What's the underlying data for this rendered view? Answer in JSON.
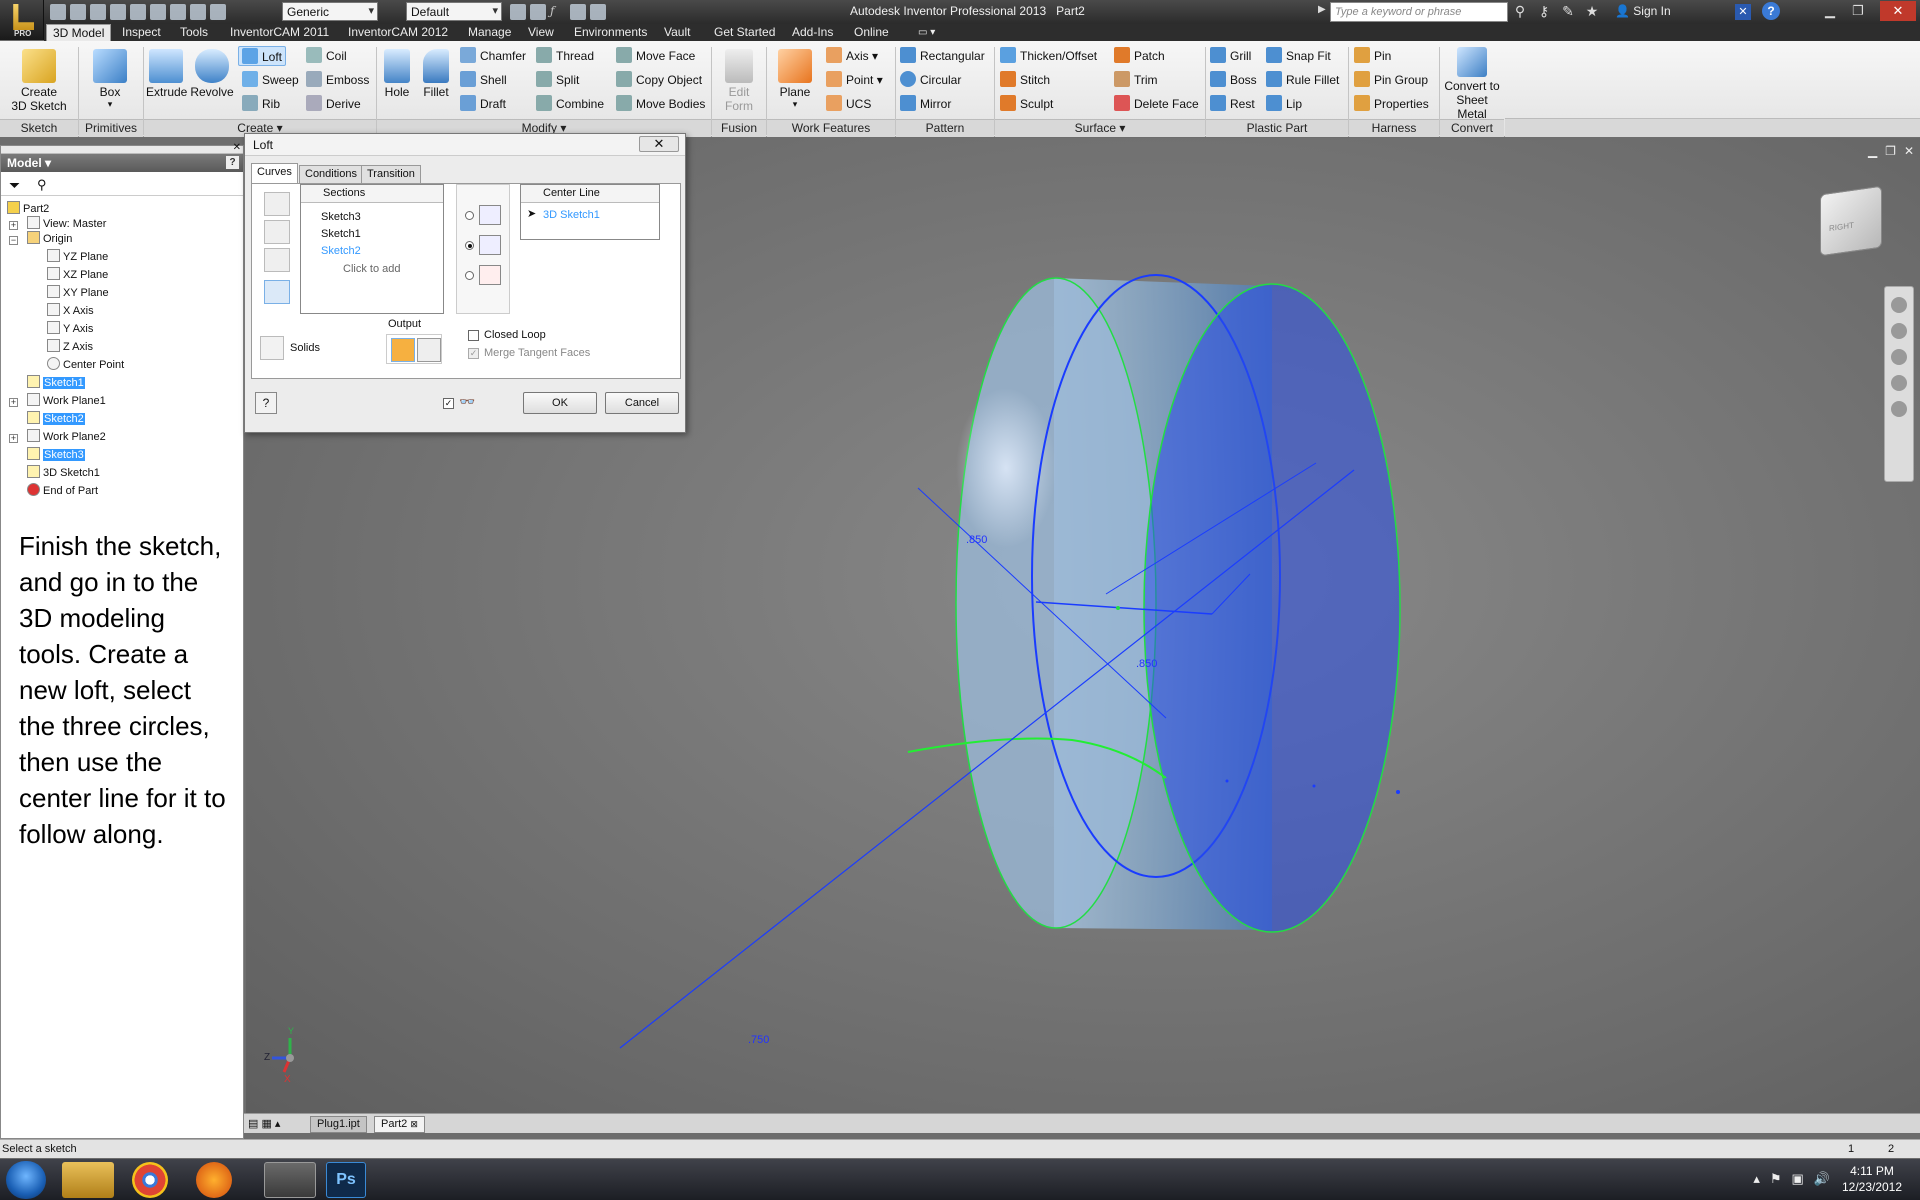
{
  "titlebar": {
    "title": "Autodesk Inventor Professional 2013",
    "doc": "Part2",
    "app_badge": "PRO",
    "material_combo": "Generic",
    "appearance_combo": "Default",
    "search_placeholder": "Type a keyword or phrase",
    "sign_in": "Sign In"
  },
  "menu": {
    "tabs": [
      "3D Model",
      "Inspect",
      "Tools",
      "InventorCAM 2011",
      "InventorCAM 2012",
      "Manage",
      "View",
      "Environments",
      "Vault",
      "Get Started",
      "Add-Ins",
      "Online"
    ],
    "active": "3D Model"
  },
  "ribbon": {
    "sketch": {
      "create_line1": "Create",
      "create_line2": "3D Sketch",
      "label": "Sketch"
    },
    "primitives": {
      "box": "Box",
      "label": "Primitives"
    },
    "create": {
      "extrude": "Extrude",
      "revolve": "Revolve",
      "loft": "Loft",
      "sweep": "Sweep",
      "rib": "Rib",
      "coil": "Coil",
      "emboss": "Emboss",
      "derive": "Derive",
      "label": "Create"
    },
    "modify": {
      "hole": "Hole",
      "fillet": "Fillet",
      "chamfer": "Chamfer",
      "shell": "Shell",
      "draft": "Draft",
      "thread": "Thread",
      "split": "Split",
      "combine": "Combine",
      "move_face": "Move Face",
      "copy_object": "Copy Object",
      "move_bodies": "Move Bodies",
      "label": "Modify"
    },
    "fusion": {
      "edit_line1": "Edit",
      "edit_line2": "Form",
      "label": "Fusion"
    },
    "work": {
      "plane": "Plane",
      "axis": "Axis",
      "point": "Point",
      "ucs": "UCS",
      "label": "Work Features"
    },
    "pattern": {
      "rectangular": "Rectangular",
      "circular": "Circular",
      "mirror": "Mirror",
      "label": "Pattern"
    },
    "surface": {
      "thicken": "Thicken/Offset",
      "stitch": "Stitch",
      "sculpt": "Sculpt",
      "patch": "Patch",
      "trim": "Trim",
      "delete_face": "Delete Face",
      "label": "Surface"
    },
    "plastic": {
      "grill": "Grill",
      "boss": "Boss",
      "rest": "Rest",
      "snap_fit": "Snap Fit",
      "rule_fillet": "Rule Fillet",
      "lip": "Lip",
      "label": "Plastic Part"
    },
    "harness": {
      "pin": "Pin",
      "pin_group": "Pin Group",
      "properties": "Properties",
      "label": "Harness"
    },
    "convert": {
      "line1": "Convert to",
      "line2": "Sheet Metal",
      "label": "Convert"
    }
  },
  "browser": {
    "header": "Model",
    "tree": {
      "part": "Part2",
      "view": "View: Master",
      "origin": "Origin",
      "yz": "YZ Plane",
      "xz": "XZ Plane",
      "xy": "XY Plane",
      "xaxis": "X Axis",
      "yaxis": "Y Axis",
      "zaxis": "Z Axis",
      "center": "Center Point",
      "sketch1": "Sketch1",
      "wp1": "Work Plane1",
      "sketch2": "Sketch2",
      "wp2": "Work Plane2",
      "sketch3": "Sketch3",
      "sketch3d": "3D Sketch1",
      "end": "End of Part"
    },
    "instructions": "Finish the sketch, and go in to the 3D modeling tools. Create a new loft, select the three circles, then use the center line for it to follow along."
  },
  "loft": {
    "title": "Loft",
    "tabs": [
      "Curves",
      "Conditions",
      "Transition"
    ],
    "active_tab": "Curves",
    "sections_header": "Sections",
    "sections": [
      "Sketch3",
      "Sketch1",
      "Sketch2"
    ],
    "sections_add": "Click to add",
    "rail_header": "Center Line",
    "rail_item": "3D Sketch1",
    "solids": "Solids",
    "output_label": "Output",
    "closed_loop": "Closed Loop",
    "merge_tangent": "Merge Tangent Faces",
    "ok": "OK",
    "cancel": "Cancel",
    "selected_mode": 1
  },
  "viewport": {
    "dims": {
      "d1": ".850",
      "d2": ".850",
      "d3": ".750"
    },
    "viewcube": "RIGHT",
    "triad": {
      "x": "X",
      "y": "Y",
      "z": "Z"
    }
  },
  "doctabs": {
    "tab1": "Plug1.ipt",
    "tab2": "Part2"
  },
  "status": {
    "text": "Select a sketch",
    "n1": "1",
    "n2": "2"
  },
  "clock": {
    "time": "4:11 PM",
    "date": "12/23/2012"
  },
  "colors": {
    "accent": "#3399ff",
    "edge_green": "#22dd44",
    "edge_blue": "#1a3cff"
  }
}
